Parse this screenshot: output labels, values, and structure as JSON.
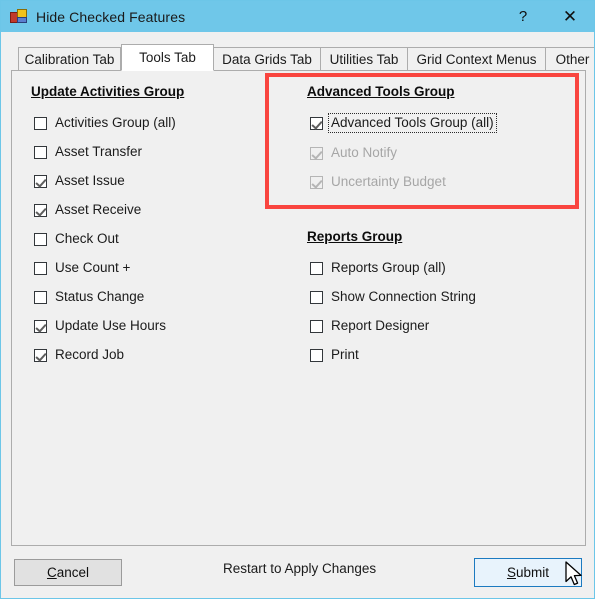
{
  "window": {
    "title": "Hide Checked Features",
    "icon": "app-form-icon",
    "help_label": "?",
    "close_label": "✕",
    "border_color": "#6CC6E8",
    "titlebar_color": "#6FC7E9",
    "panel_color": "#F0F0F0"
  },
  "tabs": [
    {
      "label": "Calibration Tab",
      "active": false
    },
    {
      "label": "Tools Tab",
      "active": true
    },
    {
      "label": "Data Grids Tab",
      "active": false
    },
    {
      "label": "Utilities Tab",
      "active": false
    },
    {
      "label": "Grid Context Menus",
      "active": false
    },
    {
      "label": "Other",
      "active": false
    }
  ],
  "groups": {
    "update_activities": {
      "title": "Update Activities Group",
      "items": [
        {
          "label": "Activities Group (all)",
          "checked": false,
          "disabled": false,
          "focused": false
        },
        {
          "label": "Asset Transfer",
          "checked": false,
          "disabled": false,
          "focused": false
        },
        {
          "label": "Asset Issue",
          "checked": true,
          "disabled": false,
          "focused": false
        },
        {
          "label": "Asset Receive",
          "checked": true,
          "disabled": false,
          "focused": false
        },
        {
          "label": "Check Out",
          "checked": false,
          "disabled": false,
          "focused": false
        },
        {
          "label": "Use Count +",
          "checked": false,
          "disabled": false,
          "focused": false
        },
        {
          "label": "Status Change",
          "checked": false,
          "disabled": false,
          "focused": false
        },
        {
          "label": "Update Use Hours",
          "checked": true,
          "disabled": false,
          "focused": false
        },
        {
          "label": "Record Job",
          "checked": true,
          "disabled": false,
          "focused": false
        }
      ]
    },
    "advanced_tools": {
      "title": "Advanced Tools Group",
      "highlighted": true,
      "highlight_color": "#F9453F",
      "items": [
        {
          "label": "Advanced Tools Group (all)",
          "checked": true,
          "disabled": false,
          "focused": true
        },
        {
          "label": "Auto Notify",
          "checked": true,
          "disabled": true,
          "focused": false
        },
        {
          "label": "Uncertainty Budget",
          "checked": true,
          "disabled": true,
          "focused": false
        }
      ]
    },
    "reports": {
      "title": "Reports Group",
      "items": [
        {
          "label": "Reports Group (all)",
          "checked": false,
          "disabled": false,
          "focused": false
        },
        {
          "label": "Show Connection String",
          "checked": false,
          "disabled": false,
          "focused": false
        },
        {
          "label": "Report Designer",
          "checked": false,
          "disabled": false,
          "focused": false
        },
        {
          "label": "Print",
          "checked": false,
          "disabled": false,
          "focused": false
        }
      ]
    }
  },
  "footer": {
    "cancel_label": "Cancel",
    "cancel_mnemonic": "C",
    "restart_note": "Restart to Apply Changes",
    "submit_label": "Submit",
    "submit_mnemonic": "S",
    "submit_accent": "#1C7AC0"
  }
}
